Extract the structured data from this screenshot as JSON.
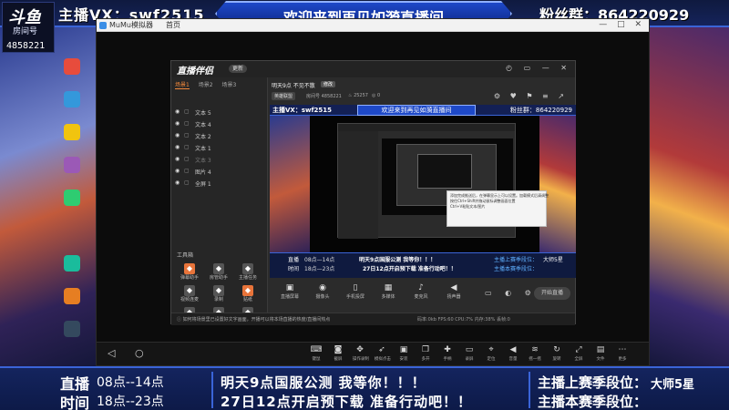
{
  "top": {
    "logo_text": "斗鱼",
    "logo_room_label": "房间号",
    "logo_room_number": "4858221",
    "host_vx": "主播VX：swf2515",
    "welcome": "欢迎来到再见如漪直播间",
    "fans_group": "粉丝群：864220929"
  },
  "emulator": {
    "title": "MuMu模拟器",
    "tab": "首页",
    "window_controls": "— □ ✕",
    "nav": {
      "back": "◁",
      "home": "○"
    },
    "toolbar": [
      {
        "icon": "keyboard-icon",
        "glyph": "⌨",
        "label": "键鼠"
      },
      {
        "icon": "camera-icon",
        "glyph": "◙",
        "label": "截屏"
      },
      {
        "icon": "operation-icon",
        "glyph": "✥",
        "label": "操作录制"
      },
      {
        "icon": "cursor-icon",
        "glyph": "➶",
        "label": "模拟点击"
      },
      {
        "icon": "apk-icon",
        "glyph": "▣",
        "label": "安装"
      },
      {
        "icon": "window-icon",
        "glyph": "❐",
        "label": "多开"
      },
      {
        "icon": "gamepad-icon",
        "glyph": "✚",
        "label": "手柄"
      },
      {
        "icon": "screen-icon",
        "glyph": "▭",
        "label": "录屏"
      },
      {
        "icon": "gps-icon",
        "glyph": "⌖",
        "label": "定位"
      },
      {
        "icon": "volume-icon",
        "glyph": "◀",
        "label": "音量"
      },
      {
        "icon": "shake-icon",
        "glyph": "≋",
        "label": "摇一摇"
      },
      {
        "icon": "rotate-icon",
        "glyph": "↻",
        "label": "旋转"
      },
      {
        "icon": "fullscreen-icon",
        "glyph": "⤢",
        "label": "全屏"
      },
      {
        "icon": "folder-icon",
        "glyph": "▤",
        "label": "文件"
      },
      {
        "icon": "more-icon",
        "glyph": "⋯",
        "label": "更多"
      }
    ]
  },
  "app": {
    "logo": "直播伴侣",
    "version": "更新",
    "window_controls": "◴ ▭ — ✕",
    "scene_tabs": [
      "场景1",
      "场景2",
      "场景3"
    ],
    "layers": [
      {
        "name": "文本 5",
        "dim": false
      },
      {
        "name": "文本 4",
        "dim": false
      },
      {
        "name": "文本 2",
        "dim": false
      },
      {
        "name": "文本 1",
        "dim": false
      },
      {
        "name": "文本 3",
        "dim": true
      },
      {
        "name": "图片 4",
        "dim": false
      },
      {
        "name": "全屏 1",
        "dim": false
      }
    ],
    "tools_title": "工具箱",
    "tools": [
      {
        "icon": "gift-icon",
        "label": "弹幕助手",
        "color": "#e8743a"
      },
      {
        "icon": "person-icon",
        "label": "房管助手",
        "color": "#555555"
      },
      {
        "icon": "task-icon",
        "label": "主播任务",
        "color": "#555555"
      },
      {
        "icon": "video-icon",
        "label": "视频连麦",
        "color": "#555555"
      },
      {
        "icon": "download-icon",
        "label": "录制",
        "color": "#555555"
      },
      {
        "icon": "shop-icon",
        "label": "贴纸",
        "color": "#e8743a"
      },
      {
        "icon": "upload-icon",
        "label": "上传视频",
        "color": "#555555"
      },
      {
        "icon": "screen-share-icon",
        "label": "弹幕墙",
        "color": "#555555"
      },
      {
        "icon": "picture-icon",
        "label": "直播回放",
        "color": "#555555"
      }
    ],
    "room_name": "明天9点 不见不散",
    "room_badge": "修改",
    "category": "英雄联盟",
    "room_id": "房间号 4858221",
    "hot": "♨ 25257",
    "fans": "◎ 0",
    "mid_icons": "⚙ ♥ ⚑ ≡ ↗",
    "preview": {
      "top_left": "主播VX：swf2515",
      "top_center": "欢迎来到再见如漪直播间",
      "top_right": "粉丝群：864220929",
      "tooltip_lines": [
        "添加完成推送后，在弹幕显示上可以设置。加载模式后请调整",
        "按住Ctrl+Shift并拖动鼠标调整画面位置",
        "Ctrl+V粘贴文本/图片"
      ],
      "bottom_label1": "直播",
      "bottom_label2": "时间",
      "bottom_time1": "08点—14点",
      "bottom_time2": "18点—23点",
      "bottom_msg1": "明天9点国服公测 我等你！！！",
      "bottom_msg2": "27日12点开启预下载 准备行动吧！！",
      "bottom_rank1": "主播上赛季段位：",
      "bottom_rank2": "主播本赛季段位：",
      "bottom_rank_val": "大师5星"
    },
    "controls": [
      {
        "icon": "live-icon",
        "glyph": "▣",
        "label": "直播屏幕"
      },
      {
        "icon": "camera-icon",
        "glyph": "◉",
        "label": "摄像头"
      },
      {
        "icon": "phone-icon",
        "glyph": "▯",
        "label": "手机投屏"
      },
      {
        "icon": "media-icon",
        "glyph": "▦",
        "label": "多媒体"
      },
      {
        "icon": "mic-icon",
        "glyph": "♪",
        "label": "麦克风"
      },
      {
        "icon": "speaker-icon",
        "glyph": "◀",
        "label": "扬声器"
      }
    ],
    "ctl_icons": "▭ ◐ ⚙",
    "go_live": "开始直播",
    "status_msg": "ⓘ 如何将场景里已设置好文字画面，开播可以将本场直播的热度/直播间热点",
    "status_stats": "码率:0kb  FPS:60  CPU:7%  内存:38%  丢帧:0"
  },
  "bottom": {
    "label1": "直播",
    "label2": "时间",
    "time1": "08点--14点",
    "time2": "18点--23点",
    "msg1": "明天9点国服公测  我等你！！！",
    "msg2": "27日12点开启预下载  准备行动吧！！",
    "rank1": "主播上赛季段位：",
    "rank2": "主播本赛季段位：",
    "rank_val": "大师5星"
  },
  "colors": {
    "accent_blue": "#3a64d8",
    "banner_blue": "#1e49c8",
    "app_orange": "#f48a3c"
  }
}
